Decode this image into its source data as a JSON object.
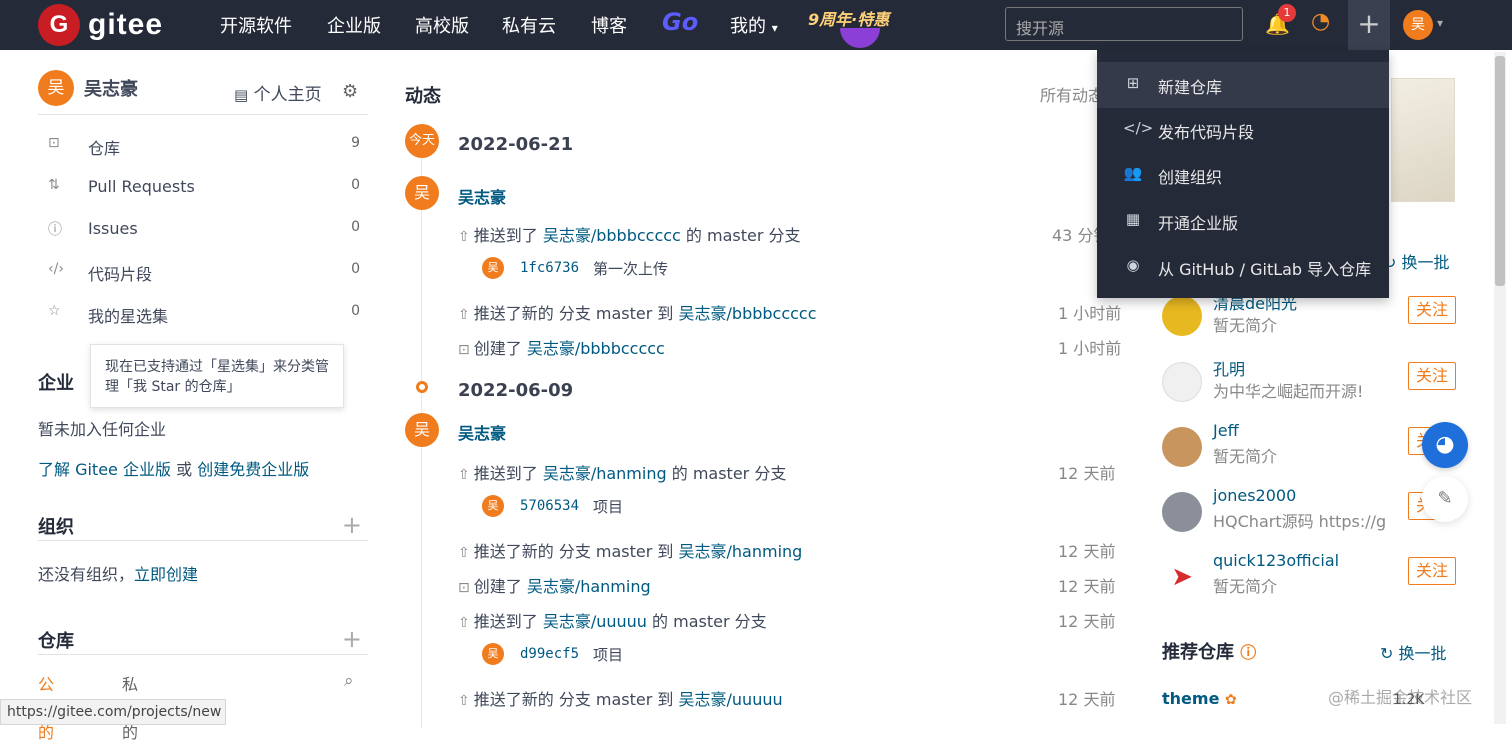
{
  "nav": {
    "logo_text": "gitee",
    "items": [
      "开源软件",
      "企业版",
      "高校版",
      "私有云",
      "博客"
    ],
    "go": "Go",
    "mine": "我的",
    "promo": "9周年·特惠",
    "search_placeholder": "搜开源",
    "notif_count": "1",
    "avatar": "吴"
  },
  "dropdown": {
    "items": [
      "新建仓库",
      "发布代码片段",
      "创建组织",
      "开通企业版",
      "从 GitHub / GitLab 导入仓库"
    ]
  },
  "sidebar": {
    "user_name": "吴志豪",
    "avatar": "吴",
    "home_link": "个人主页",
    "items": [
      {
        "label": "仓库",
        "count": "9"
      },
      {
        "label": "Pull Requests",
        "count": "0"
      },
      {
        "label": "Issues",
        "count": "0"
      },
      {
        "label": "代码片段",
        "count": "0"
      },
      {
        "label": "我的星选集",
        "count": "0"
      }
    ],
    "tooltip": "现在已支持通过「星选集」来分类管理「我 Star 的仓库」",
    "enterprise": {
      "title": "企业",
      "text": "暂未加入任何企业",
      "link1": "了解 Gitee 企业版",
      "or": "或",
      "link2": "创建免费企业版"
    },
    "org": {
      "title": "组织",
      "text": "还没有组织，",
      "link": "立即创建"
    },
    "repo": {
      "title": "仓库",
      "tab_public": "公开的",
      "tab_private": "私有的"
    },
    "status_url": "https://gitee.com/projects/new"
  },
  "feed": {
    "title": "动态",
    "filter": "所有动态",
    "today": "今天",
    "dates": [
      "2022-06-21",
      "2022-06-09"
    ],
    "user": "吴志豪",
    "avatar": "吴",
    "g1": [
      {
        "pre": "推送到了 ",
        "link": "吴志豪/bbbbccccc",
        "post": " 的 master 分支",
        "time": "43 分钟前",
        "commit": {
          "hash": "1fc6736",
          "msg": "第一次上传"
        }
      },
      {
        "pre": "推送了新的 分支 master 到 ",
        "link": "吴志豪/bbbbccccc",
        "post": "",
        "time": "1 小时前"
      },
      {
        "pre": "创建了 ",
        "link": "吴志豪/bbbbccccc",
        "post": "",
        "time": "1 小时前"
      }
    ],
    "g2": [
      {
        "pre": "推送到了 ",
        "link": "吴志豪/hanming",
        "post": " 的 master 分支",
        "time": "12 天前",
        "commit": {
          "hash": "5706534",
          "msg": "项目"
        }
      },
      {
        "pre": "推送了新的 分支 master 到 ",
        "link": "吴志豪/hanming",
        "post": "",
        "time": "12 天前"
      },
      {
        "pre": "创建了 ",
        "link": "吴志豪/hanming",
        "post": "",
        "time": "12 天前"
      },
      {
        "pre": "推送到了 ",
        "link": "吴志豪/uuuuu",
        "post": " 的 master 分支",
        "time": "12 天前",
        "commit": {
          "hash": "d99ecf5",
          "msg": "项目"
        }
      },
      {
        "pre": "推送了新的 分支 master 到 ",
        "link": "吴志豪/uuuuu",
        "post": "",
        "time": "12 天前"
      }
    ]
  },
  "right": {
    "refresh": "换一批",
    "people": [
      {
        "name": "清晨de阳光",
        "desc": "暂无简介",
        "follow": "关注",
        "color": "#e8b820"
      },
      {
        "name": "孔明",
        "desc": "为中华之崛起而开源!",
        "follow": "关注",
        "color": "#f0f0f0"
      },
      {
        "name": "Jeff",
        "desc": "暂无简介",
        "follow": "关注",
        "color": "#c9955e"
      },
      {
        "name": "jones2000",
        "desc": "HQChart源码 https://gi...",
        "follow": "关注",
        "color": "#8a8f99"
      },
      {
        "name": "quick123official",
        "desc": "暂无简介",
        "follow": "关注",
        "color": "#d62c2c"
      }
    ],
    "rec_title": "推荐仓库",
    "rec_refresh": "换一批",
    "theme": "theme",
    "watermark": "@稀土掘金技术社区",
    "likes": "1.2K"
  }
}
